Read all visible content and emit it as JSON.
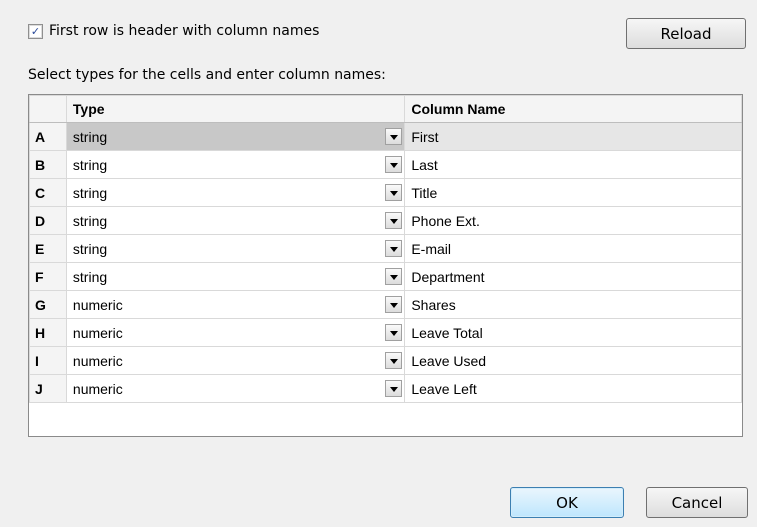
{
  "header": {
    "checkbox_checked": true,
    "checkbox_mark": "✓",
    "checkbox_label": "First row is header with column names",
    "reload_label": "Reload"
  },
  "instructions": "Select types for the cells and enter column names:",
  "grid": {
    "columns": {
      "type": "Type",
      "name": "Column Name"
    },
    "selected_row": 0,
    "rows": [
      {
        "letter": "A",
        "type": "string",
        "name": "First"
      },
      {
        "letter": "B",
        "type": "string",
        "name": "Last"
      },
      {
        "letter": "C",
        "type": "string",
        "name": "Title"
      },
      {
        "letter": "D",
        "type": "string",
        "name": "Phone Ext."
      },
      {
        "letter": "E",
        "type": "string",
        "name": "E-mail"
      },
      {
        "letter": "F",
        "type": "string",
        "name": "Department"
      },
      {
        "letter": "G",
        "type": "numeric",
        "name": "Shares"
      },
      {
        "letter": "H",
        "type": "numeric",
        "name": "Leave Total"
      },
      {
        "letter": "I",
        "type": "numeric",
        "name": "Leave Used"
      },
      {
        "letter": "J",
        "type": "numeric",
        "name": "Leave Left"
      }
    ]
  },
  "footer": {
    "ok_label": "OK",
    "cancel_label": "Cancel"
  }
}
